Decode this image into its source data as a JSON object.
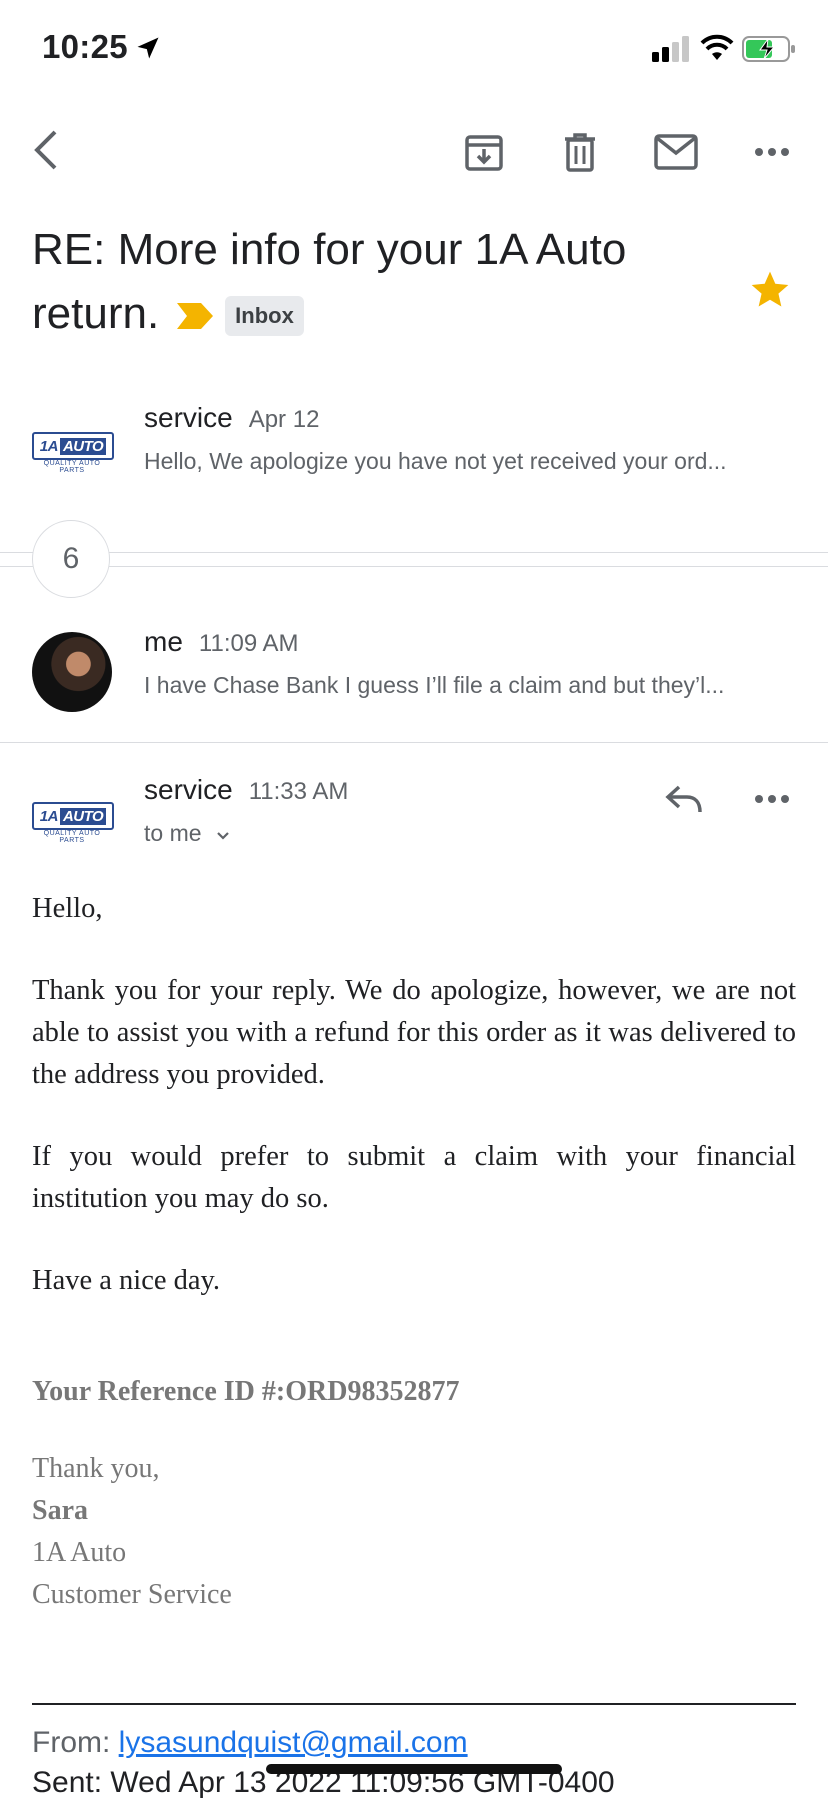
{
  "status_bar": {
    "time": "10:25"
  },
  "toolbar": {
    "icons": [
      "back-arrow-icon",
      "archive-icon",
      "trash-icon",
      "mail-icon",
      "more-horizontal-icon"
    ]
  },
  "subject": {
    "line1": "RE: More info for your 1A Auto",
    "line2": "return.",
    "label": "Inbox",
    "starred": true,
    "accent": "#f4b400"
  },
  "messages": [
    {
      "sender": "service",
      "date": "Apr 12",
      "snippet": "Hello, We apologize you have not yet received your ord..."
    },
    {
      "collapsed_count": "6"
    },
    {
      "sender": "me",
      "date": "11:09 AM",
      "snippet": "I have Chase Bank I guess I’ll file a claim and but they’l..."
    },
    {
      "sender": "service",
      "date": "11:33 AM",
      "recipient": "to me"
    }
  ],
  "logo": {
    "brand": "1A",
    "brand_box": "AUTO",
    "tagline": "QUALITY AUTO PARTS"
  },
  "body": {
    "greeting": "Hello,",
    "para1": "Thank you for your reply. We do apologize, however, we are not able to assist you with a refund for this order as it was delivered to the address you provided.",
    "para2": "If you would prefer to submit a claim with your financial institution you may do so.",
    "para3": "Have a nice day.",
    "reference": "Your Reference ID #:ORD98352877",
    "signoff": "Thank you,",
    "sig_name": "Sara",
    "sig_company": "1A Auto",
    "sig_dept": "Customer Service"
  },
  "quoted": {
    "from_label": "From:",
    "from_email": "lysasundquist@gmail.com",
    "sent": "Sent: Wed Apr 13 2022 11:09:56 GMT-0400"
  }
}
